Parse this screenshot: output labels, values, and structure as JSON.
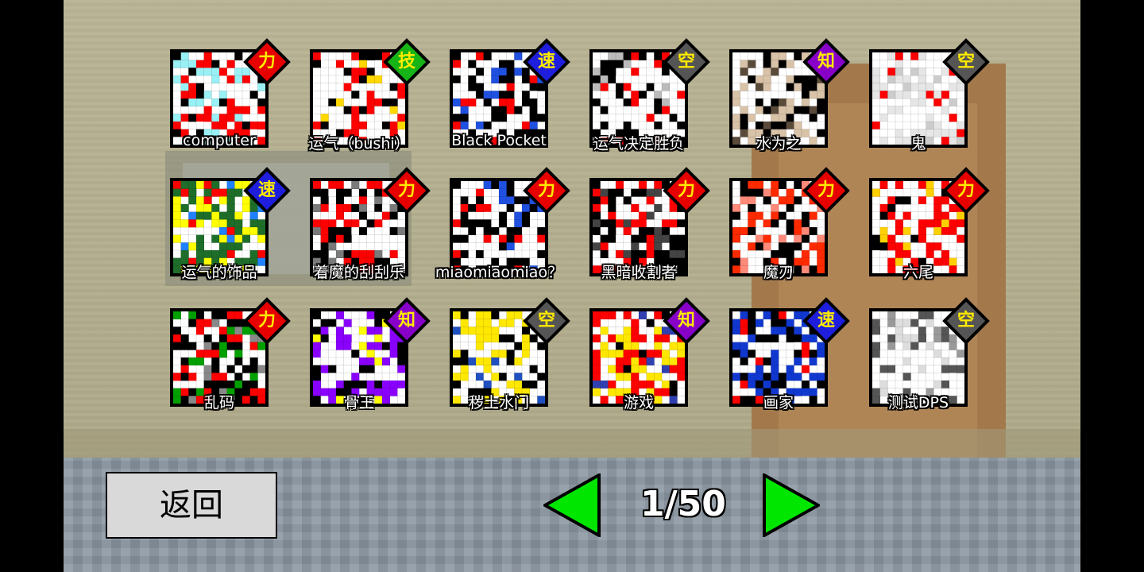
{
  "badge_colors": {
    "力": "#e60000",
    "技": "#16b416",
    "速": "#1e1edc",
    "空": "#555555",
    "知": "#8800c8"
  },
  "cards": [
    {
      "name": "computer",
      "badge": "力",
      "icon": "computer-portrait-icon",
      "palette": [
        "#ff0000",
        "#99f0f5",
        "#000000",
        "#ffffff"
      ]
    },
    {
      "name": "运气（bushi）",
      "badge": "技",
      "icon": "rainbow-orb-portrait-icon",
      "palette": [
        "#ffffff",
        "#ff0000",
        "#000000",
        "#ffd800"
      ]
    },
    {
      "name": "Black Pocket",
      "badge": "速",
      "icon": "black-pocket-portrait-icon",
      "palette": [
        "#000000",
        "#ffffff",
        "#2050e0",
        "#ff0000"
      ]
    },
    {
      "name": "运气决定胜负",
      "badge": "空",
      "icon": "dice-ghost-portrait-icon",
      "palette": [
        "#ffffff",
        "#000000",
        "#ff0000",
        "#bbbbbb"
      ]
    },
    {
      "name": "水为之",
      "badge": "知",
      "icon": "surprised-cat-portrait-icon",
      "palette": [
        "#d8c2a8",
        "#000000",
        "#ffffff",
        "#5a4a3a"
      ]
    },
    {
      "name": "鬼",
      "badge": "空",
      "icon": "ghost-portrait-icon",
      "palette": [
        "#e6e6e6",
        "#ffffff",
        "#ff0000",
        "#cccccc"
      ]
    },
    {
      "name": "运气的饰品",
      "badge": "速",
      "icon": "lucky-charm-portrait-icon",
      "palette": [
        "#1e6e2a",
        "#ffff00",
        "#ff0000",
        "#2080ff"
      ]
    },
    {
      "name": "着魔的刮刮乐",
      "badge": "力",
      "icon": "scratch-card-portrait-icon",
      "palette": [
        "#000000",
        "#ff0000",
        "#ffffff",
        "#7a7a7a"
      ]
    },
    {
      "name": "miaomiaomiao？",
      "badge": "力",
      "icon": "cat-girl-portrait-icon",
      "palette": [
        "#000000",
        "#ffffff",
        "#ff0000",
        "#2050e0"
      ]
    },
    {
      "name": "黑暗收割者",
      "badge": "力",
      "icon": "reaper-portrait-icon",
      "palette": [
        "#000000",
        "#ff0000",
        "#ffffff",
        "#444444"
      ]
    },
    {
      "name": "魔刃",
      "badge": "力",
      "icon": "demon-blade-portrait-icon",
      "palette": [
        "#ff2a00",
        "#000000",
        "#ffffff",
        "#ff8a7a"
      ]
    },
    {
      "name": "六尾",
      "badge": "力",
      "icon": "six-tails-portrait-icon",
      "palette": [
        "#ff0000",
        "#ffffff",
        "#000000",
        "#ffd000"
      ]
    },
    {
      "name": "乱码",
      "badge": "力",
      "icon": "glitch-portrait-icon",
      "palette": [
        "#000000",
        "#ff0000",
        "#00a000",
        "#888888"
      ]
    },
    {
      "name": "骨王",
      "badge": "知",
      "icon": "bone-king-portrait-icon",
      "palette": [
        "#8a00ff",
        "#000000",
        "#ffffff",
        "#ffff00"
      ]
    },
    {
      "name": "秽土水门",
      "badge": "空",
      "icon": "yellow-hair-portrait-icon",
      "palette": [
        "#ffe800",
        "#000000",
        "#ffffff",
        "#2050c0"
      ]
    },
    {
      "name": "游戏",
      "badge": "知",
      "icon": "game-portrait-icon",
      "palette": [
        "#ff0000",
        "#ffe800",
        "#000000",
        "#3040b0"
      ]
    },
    {
      "name": "画家",
      "badge": "速",
      "icon": "painter-portrait-icon",
      "palette": [
        "#1038d0",
        "#000000",
        "#ff0000",
        "#ffffff"
      ]
    },
    {
      "name": "测试DPS",
      "badge": "空",
      "icon": "paperclip-portrait-icon",
      "palette": [
        "#ffffff",
        "#555555",
        "#dddddd",
        "#999999"
      ]
    }
  ],
  "footer": {
    "back_label": "返回",
    "page_text": "1/50",
    "prev_icon": "left-arrow-icon",
    "next_icon": "right-arrow-icon",
    "arrow_color": "#00e600"
  }
}
